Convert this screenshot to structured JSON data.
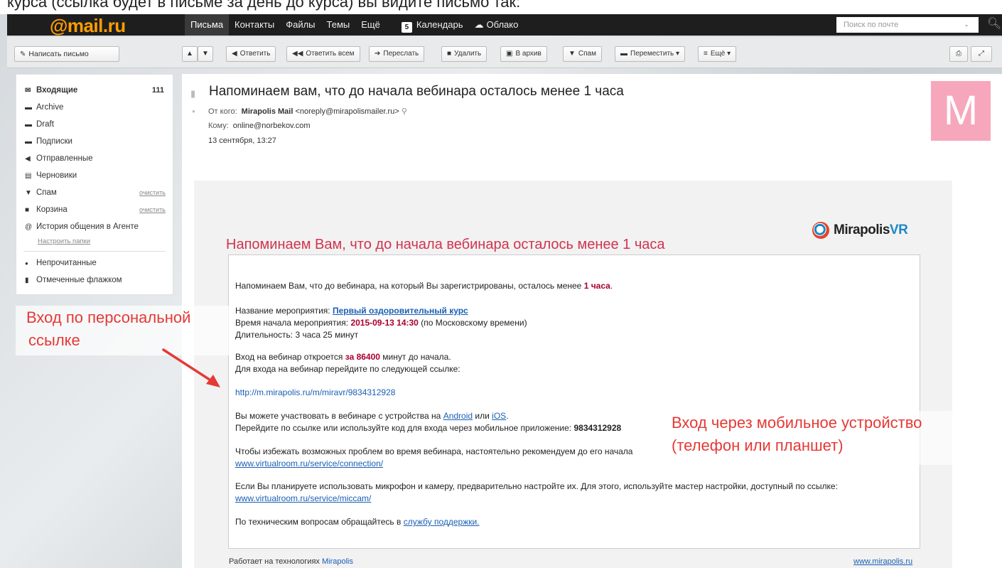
{
  "top_caption": "курса (ссылка будет в письме за день до курса) вы видите письмо так:",
  "header": {
    "logo": "@mail.ru",
    "nav": [
      {
        "label": "Письма",
        "active": true
      },
      {
        "label": "Контакты"
      },
      {
        "label": "Файлы"
      },
      {
        "label": "Темы"
      },
      {
        "label": "Ещё"
      },
      {
        "label": "Календарь",
        "icon": "calendar-icon",
        "icon_text": "5"
      },
      {
        "label": "Облако",
        "icon": "cloud-icon"
      }
    ],
    "search_placeholder": "Поиск по почте",
    "search_dropdown": "-"
  },
  "toolbar": {
    "compose": "Написать письмо",
    "reply": "Ответить",
    "reply_all": "Ответить всем",
    "forward": "Переслать",
    "delete": "Удалить",
    "archive": "В архив",
    "spam": "Спам",
    "move": "Переместить",
    "more": "Ещё"
  },
  "sidebar": {
    "folders": [
      {
        "label": "Входящие",
        "count": "111",
        "icon": "envelope-icon"
      },
      {
        "label": "Archive",
        "icon": "folder-icon"
      },
      {
        "label": "Draft",
        "icon": "folder-icon"
      },
      {
        "label": "Подписки",
        "icon": "folder-icon"
      },
      {
        "label": "Отправленные",
        "icon": "sent-icon"
      },
      {
        "label": "Черновики",
        "icon": "drafts-icon"
      },
      {
        "label": "Спам",
        "action": "очистить",
        "icon": "spam-icon"
      },
      {
        "label": "Корзина",
        "action": "очистить",
        "icon": "trash-icon"
      },
      {
        "label": "История общения в Агенте",
        "icon": "agent-icon"
      }
    ],
    "setup_link": "Настроить папки",
    "filters": [
      {
        "label": "Непрочитанные",
        "icon": "unread-dot-icon"
      },
      {
        "label": "Отмеченные флажком",
        "icon": "flag-icon"
      }
    ]
  },
  "message": {
    "subject": "Напоминаем вам, что до начала вебинара осталось менее 1 часа",
    "from_label": "От кого:",
    "from_name": "Mirapolis Mail",
    "from_email": "<noreply@mirapolismailer.ru>",
    "to_label": "Кому:",
    "to": "online@norbekov.com",
    "date": "13 сентября, 13:27",
    "avatar_letter": "M"
  },
  "email": {
    "brand": "Mirapolis",
    "brand_vr": "VR",
    "heading": "Напоминаем Вам, что до начала вебинара осталось менее 1 часа",
    "intro_prefix": "Напоминаем Вам, что до вебинара, на который Вы зарегистрированы, осталось менее",
    "intro_bold": "1 часа",
    "event_label": "Название мероприятия:",
    "event_link": "Первый оздоровительный курс",
    "start_label": "Время начала мероприятия:",
    "start_value": "2015-09-13 14:30",
    "start_suffix": "(по Московскому времени)",
    "duration": "Длительность: 3 часа 25 минут",
    "opens_prefix": "Вход на вебинар откроется",
    "opens_bold": "за 86400",
    "opens_suffix": "минут до начала.",
    "follow_link": "Для входа на вебинар перейдите по следующей ссылке:",
    "personal_link": "http://m.mirapolis.ru/m/miravr/9834312928",
    "devices_prefix": "Вы можете участвовать в вебинаре с устройства на",
    "android": "Android",
    "or": "или",
    "ios": "iOS",
    "code_prefix": "Перейдите по ссылке или используйте код для входа через мобильное приложение:",
    "code": "9834312928",
    "problems": "Чтобы избежать возможных проблем во время вебинара, настоятельно рекомендуем до его начала",
    "connection_link": "www.virtualroom.ru/service/connection/",
    "mic": "Если Вы планируете использовать микрофон и камеру, предварительно настройте их. Для этого, используйте мастер настройки, доступный по ссылке:",
    "miccam_link": "www.virtualroom.ru/service/miccam/",
    "support_prefix": "По техническим вопросам обращайтесь в",
    "support_link": "службу поддержки.",
    "footer_prefix": "Работает на технологиях",
    "footer_brand": "Mirapolis",
    "footer_site": "www.mirapolis.ru"
  },
  "annotations": {
    "personal_line1": "Вход по персональной",
    "personal_line2": "ссылке",
    "mobile_line1": "Вход через мобильное устройство",
    "mobile_line2": "(телефон или планшет)"
  },
  "colors": {
    "logo": "#ff9e00",
    "heading": "#d0344f",
    "annotation": "#e53935",
    "link": "#1a5fb4",
    "avatar": "#f7a7bc"
  }
}
